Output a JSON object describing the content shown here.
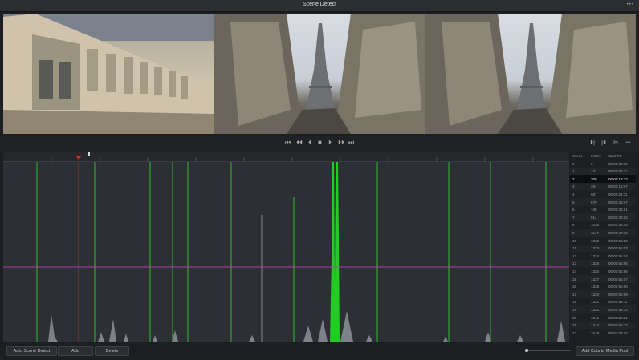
{
  "window": {
    "title": "Scene Detect",
    "controls": "•••"
  },
  "viewers": [
    {
      "name": "previous-frame-viewer"
    },
    {
      "name": "current-frame-viewer"
    },
    {
      "name": "next-frame-viewer"
    }
  ],
  "transport": {
    "go_to_start": "⏮",
    "prev_frame": "⏴⏴",
    "play_reverse": "⏴",
    "stop": "■",
    "play": "⏵",
    "next_frame": "⏵⏵",
    "go_to_end": "⏭",
    "right_1": "⏵|",
    "right_2": "|⏴",
    "right_3": "✂",
    "right_4": "☰"
  },
  "table": {
    "headers": [
      "Scene",
      "Frame",
      "Start TC"
    ],
    "selected_index": 2,
    "rows": [
      [
        "0",
        "0",
        "00:00:00:00"
      ],
      [
        "1",
        "131",
        "00:00:05:11"
      ],
      [
        "2",
        "300",
        "00:00:12:12"
      ],
      [
        "3",
        "391",
        "00:00:16:07"
      ],
      [
        "4",
        "587",
        "00:00:24:11"
      ],
      [
        "5",
        "679",
        "00:00:28:07"
      ],
      [
        "6",
        "745",
        "00:00:31:01"
      ],
      [
        "7",
        "914",
        "00:00:38:02"
      ],
      [
        "8",
        "1036",
        "00:00:43:04"
      ],
      [
        "9",
        "1147",
        "00:00:47:19"
      ],
      [
        "10",
        "1202",
        "00:00:50:02"
      ],
      [
        "11",
        "1323",
        "00:00:55:03"
      ],
      [
        "12",
        "1324",
        "00:00:55:04"
      ],
      [
        "13",
        "1325",
        "00:00:55:05"
      ],
      [
        "14",
        "1326",
        "00:00:55:06"
      ],
      [
        "15",
        "1327",
        "00:00:55:07"
      ],
      [
        "16",
        "1328",
        "00:00:55:08"
      ],
      [
        "17",
        "1329",
        "00:00:55:09"
      ],
      [
        "18",
        "1331",
        "00:00:55:11"
      ],
      [
        "19",
        "1332",
        "00:00:55:12"
      ],
      [
        "20",
        "1341",
        "00:00:55:21"
      ],
      [
        "21",
        "1343",
        "00:00:55:23"
      ],
      [
        "22",
        "1519",
        "00:01:03:07"
      ]
    ]
  },
  "buttons": {
    "auto_scene_detect": "Auto Scene Detect",
    "add": "Add",
    "delete": "Delete",
    "add_cuts": "Add Cuts to Media Pool"
  },
  "colors": {
    "cut_line": "#2fbf2f",
    "peak": "#22cc22",
    "threshold": "#c23cc2",
    "playhead": "#e0302a"
  }
}
